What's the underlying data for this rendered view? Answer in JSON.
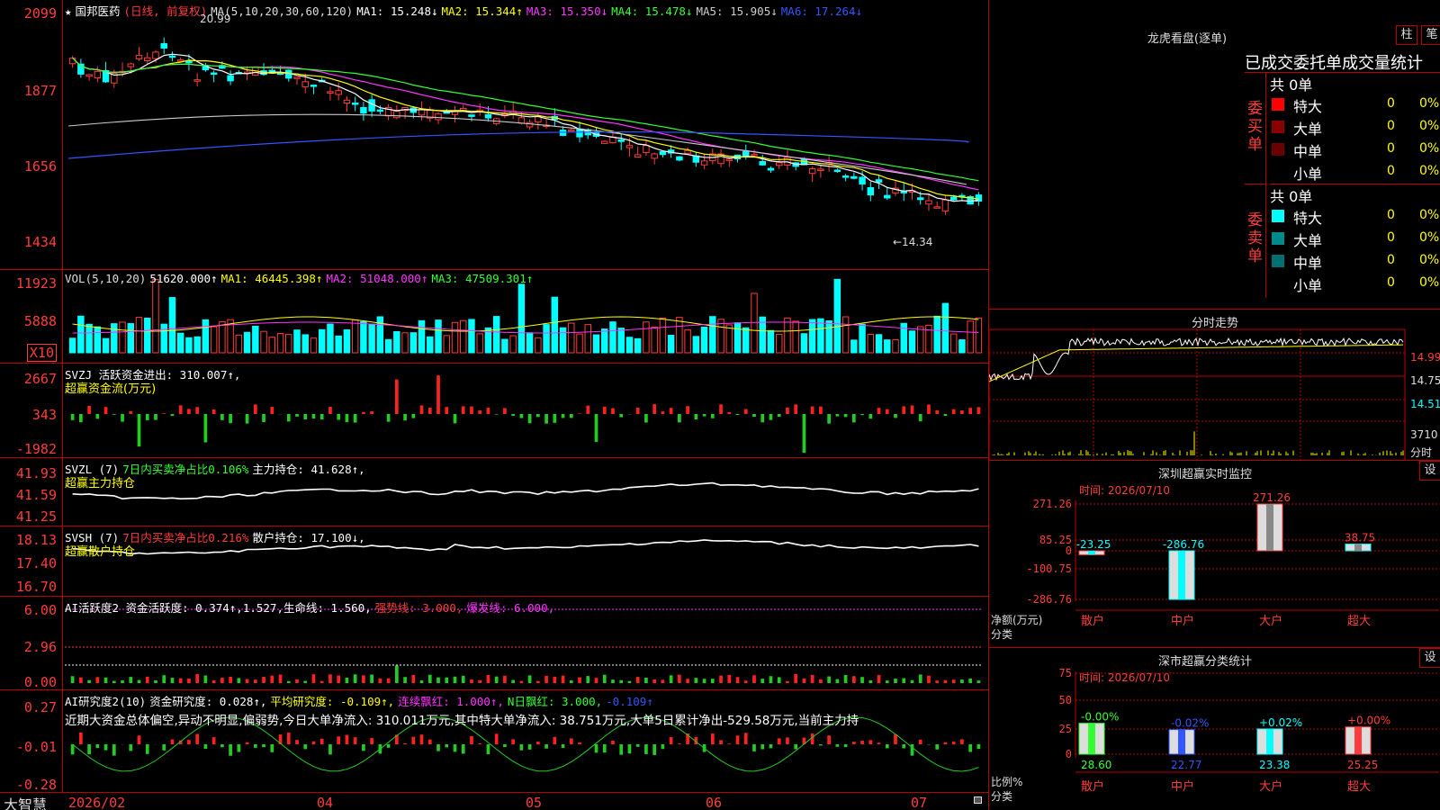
{
  "app": {
    "brand": "大智慧"
  },
  "kline": {
    "star": "★",
    "name": "国邦医药",
    "mode": "(日线, 前复权)",
    "ma_label": "MA(5,10,20,30,60,120)",
    "ma1": "MA1: 15.248↓",
    "ma2": "MA2: 15.344↑",
    "ma3": "MA3: 15.350↓",
    "ma4": "MA4: 15.478↓",
    "ma5": "MA5: 15.905↓",
    "ma6": "MA6: 17.264↓",
    "y_labels": [
      "2099",
      "1877",
      "1656",
      "1434"
    ],
    "hi_label": "20.99",
    "lo_label": "←14.34"
  },
  "vol": {
    "label": "VOL(5,10,20)",
    "value": "51620.000↑",
    "ma1": "MA1: 46445.398↑",
    "ma2": "MA2: 51048.000↑",
    "ma3": "MA3: 47509.301↑",
    "y_labels": [
      "11923",
      "5888"
    ],
    "unit": "X10"
  },
  "svzj": {
    "label": "SVZJ  活跃资金进出: 310.007↑,",
    "sub": "超赢资金流(万元)",
    "y_labels": [
      "2667",
      "343",
      "-1982"
    ]
  },
  "svzl": {
    "label": "SVZL (7)",
    "p7": "7日内买卖净占比0.106%",
    "hold": "主力持仓: 41.628↑,",
    "sub": "超赢主力持仓",
    "y_labels": [
      "41.93",
      "41.59",
      "41.25"
    ]
  },
  "svsh": {
    "label": "SVSH (7)",
    "p7": "7日内买卖净占比0.216%",
    "hold": "散户持仓: 17.100↓,",
    "sub": "超赢散户持仓",
    "y_labels": [
      "18.13",
      "17.40",
      "16.70"
    ]
  },
  "ai1": {
    "label": "AI活跃度2 资金活跃度: 0.374↑,1.527,生命线: 1.560,",
    "strong": "强势线: 3.000,",
    "burst": "爆发线: 6.000,",
    "y_labels": [
      "6.00",
      "2.96",
      "0.00"
    ]
  },
  "ai2": {
    "label": "AI研究度2(10)",
    "r1": "资金研究度: 0.028↑,",
    "r2": "平均研究度: -0.109↑,",
    "r3": "连续飘红: 1.000↑,",
    "r4": "N日飘红: 3.000,",
    "r5": "-0.109↑",
    "comment": "近期大资金总体偏空,异动不明显,偏弱势,今日大单净流入: 310.011万元,其中特大单净流入: 38.751万元,大单5日累计净出-529.58万元,当前主力持",
    "y_labels": [
      "0.27",
      "-0.01",
      "-0.28"
    ]
  },
  "xaxis": [
    "2026/02",
    "04",
    "05",
    "06",
    "07"
  ],
  "lhb": {
    "title": "龙虎看盘(逐单)",
    "btn_zhu": "柱",
    "btn_bi": "笔",
    "header": "已成交委托单成交量统计",
    "buy_side": "委买单",
    "sell_side": "委卖单",
    "buy_total": "共 0单",
    "sell_total": "共 0单",
    "rows": [
      "特大",
      "大单",
      "中单",
      "小单"
    ],
    "count": "0",
    "pct": "0%",
    "buy_colors": [
      "#ff0000",
      "#8b0000",
      "#6b0000",
      "#000000"
    ],
    "sell_colors": [
      "#00ffff",
      "#008b8b",
      "#007070",
      "#000000"
    ]
  },
  "fenshi": {
    "title": "分时走势",
    "y_labels": [
      "14.99",
      "14.75",
      "14.51",
      "3710"
    ],
    "unit": "分时"
  },
  "szjk": {
    "title": "深圳超赢实时监控",
    "btn": "设",
    "time": "时间: 2026/07/10",
    "y_labels": [
      "271.26",
      "85.25",
      "0",
      "-100.75",
      "-286.76"
    ],
    "net_label": "净额(万元)",
    "cat_label": "分类",
    "cats": [
      "散户",
      "中户",
      "大户",
      "超大"
    ],
    "values": [
      -23.25,
      -286.76,
      271.26,
      38.75
    ],
    "value_labels": [
      "-23.25",
      "-286.76",
      "271.26",
      "38.75"
    ]
  },
  "fltj": {
    "title": "深市超赢分类统计",
    "btn": "设",
    "time": "时间: 2026/07/10",
    "y_labels": [
      "75",
      "50",
      "25",
      "0"
    ],
    "ratio_label": "比例%",
    "cat_label": "分类",
    "cats": [
      "散户",
      "中户",
      "大户",
      "超大"
    ],
    "values": [
      28.6,
      22.77,
      23.38,
      25.25
    ],
    "value_labels": [
      "28.60",
      "22.77",
      "23.38",
      "25.25"
    ],
    "changes": [
      "-0.00%",
      "-0.02%",
      "+0.02%",
      "+0.00%"
    ]
  }
}
